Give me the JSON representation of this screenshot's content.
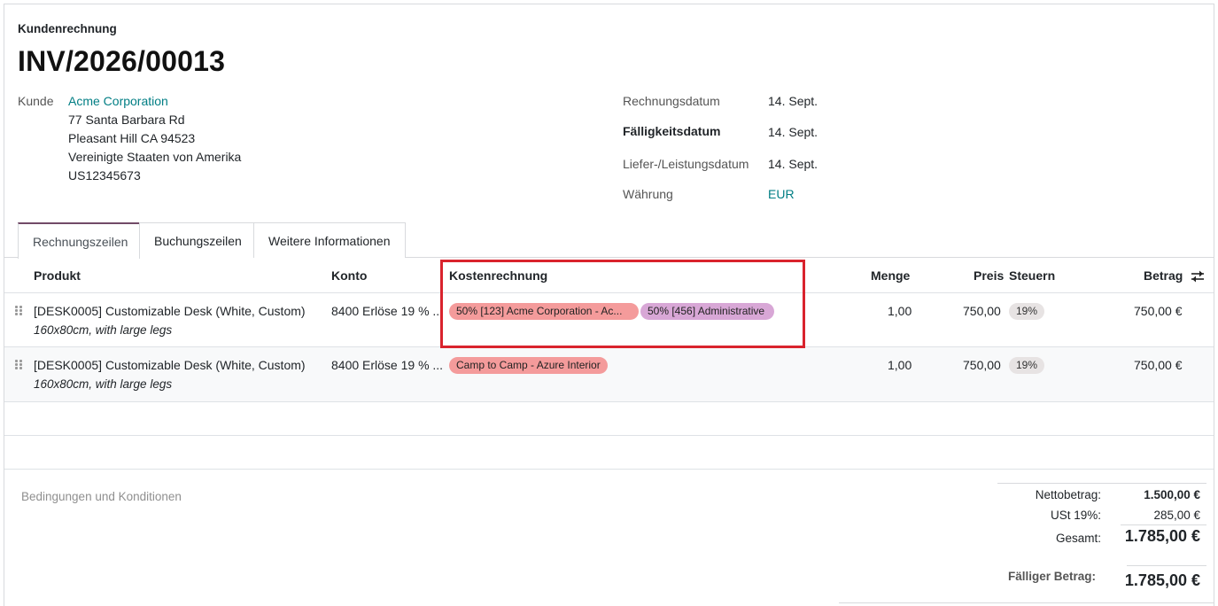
{
  "header": {
    "doc_type": "Kundenrechnung",
    "invoice_number": "INV/2026/00013"
  },
  "customer": {
    "label": "Kunde",
    "name": "Acme Corporation",
    "address_lines": [
      "77 Santa Barbara Rd",
      "Pleasant Hill CA 94523",
      "Vereinigte Staaten von Amerika",
      "US12345673"
    ]
  },
  "dates": {
    "invoice_date_label": "Rechnungsdatum",
    "invoice_date": "14. Sept.",
    "due_date_label": "Fälligkeitsdatum",
    "due_date": "14. Sept.",
    "delivery_date_label": "Liefer-/Leistungsdatum",
    "delivery_date": "14. Sept.",
    "currency_label": "Währung",
    "currency": "EUR"
  },
  "tabs": [
    {
      "label": "Rechnungszeilen",
      "active": true
    },
    {
      "label": "Buchungszeilen",
      "active": false
    },
    {
      "label": "Weitere Informationen",
      "active": false
    }
  ],
  "table": {
    "columns": {
      "product": "Produkt",
      "account": "Konto",
      "analytic": "Kostenrechnung",
      "quantity": "Menge",
      "price": "Preis",
      "taxes": "Steuern",
      "amount": "Betrag"
    },
    "rows": [
      {
        "product": "[DESK0005] Customizable Desk (White, Custom)",
        "description": "160x80cm, with large legs",
        "account": "8400 Erlöse 19 % ...",
        "tags": [
          "50% [123] Acme Corporation - Ac...",
          "50% [456] Administrative"
        ],
        "quantity": "1,00",
        "price": "750,00",
        "tax": "19%",
        "amount": "750,00 €"
      },
      {
        "product": "[DESK0005] Customizable Desk (White, Custom)",
        "description": "160x80cm, with large legs",
        "account": "8400 Erlöse 19 % ...",
        "tags": [
          "Camp to Camp - Azure Interior"
        ],
        "quantity": "1,00",
        "price": "750,00",
        "tax": "19%",
        "amount": "750,00 €"
      }
    ]
  },
  "terms_placeholder": "Bedingungen und Konditionen",
  "totals": {
    "net_label": "Nettobetrag:",
    "net_value": "1.500,00 €",
    "vat_label": "USt 19%:",
    "vat_value": "285,00 €",
    "total_label": "Gesamt:",
    "total_value": "1.785,00 €",
    "due_label": "Fälliger Betrag:",
    "due_value": "1.785,00 €"
  },
  "colors": {
    "link": "#017e84",
    "tab_accent": "#714b67",
    "highlight_box": "#d9232d",
    "tag_red": "#f49b9b",
    "tag_purple": "#d8a7d6"
  }
}
